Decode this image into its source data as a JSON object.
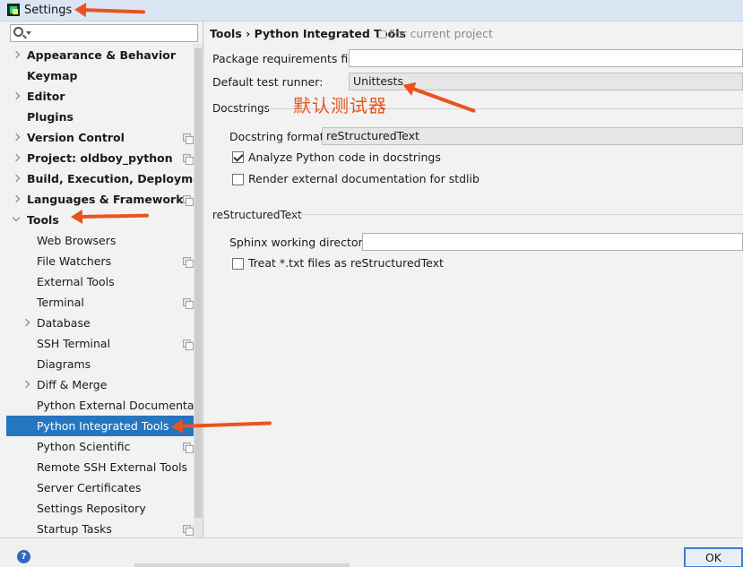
{
  "window": {
    "title": "Settings"
  },
  "search": {
    "placeholder": ""
  },
  "sidebar": {
    "items": [
      {
        "label": "Appearance & Behavior",
        "bold": true,
        "chevron": "closed",
        "indent": 0,
        "copy": false,
        "selected": false
      },
      {
        "label": "Keymap",
        "bold": true,
        "chevron": "none",
        "indent": 0,
        "copy": false,
        "selected": false
      },
      {
        "label": "Editor",
        "bold": true,
        "chevron": "closed",
        "indent": 0,
        "copy": false,
        "selected": false
      },
      {
        "label": "Plugins",
        "bold": true,
        "chevron": "none",
        "indent": 0,
        "copy": false,
        "selected": false
      },
      {
        "label": "Version Control",
        "bold": true,
        "chevron": "closed",
        "indent": 0,
        "copy": true,
        "selected": false
      },
      {
        "label": "Project: oldboy_python",
        "bold": true,
        "chevron": "closed",
        "indent": 0,
        "copy": true,
        "selected": false
      },
      {
        "label": "Build, Execution, Deployment",
        "bold": true,
        "chevron": "closed",
        "indent": 0,
        "copy": false,
        "selected": false
      },
      {
        "label": "Languages & Frameworks",
        "bold": true,
        "chevron": "closed",
        "indent": 0,
        "copy": true,
        "selected": false
      },
      {
        "label": "Tools",
        "bold": true,
        "chevron": "open",
        "indent": 0,
        "copy": false,
        "selected": false
      },
      {
        "label": "Web Browsers",
        "bold": false,
        "chevron": "none",
        "indent": 1,
        "copy": false,
        "selected": false
      },
      {
        "label": "File Watchers",
        "bold": false,
        "chevron": "none",
        "indent": 1,
        "copy": true,
        "selected": false
      },
      {
        "label": "External Tools",
        "bold": false,
        "chevron": "none",
        "indent": 1,
        "copy": false,
        "selected": false
      },
      {
        "label": "Terminal",
        "bold": false,
        "chevron": "none",
        "indent": 1,
        "copy": true,
        "selected": false
      },
      {
        "label": "Database",
        "bold": false,
        "chevron": "closed",
        "indent": 1,
        "copy": false,
        "selected": false
      },
      {
        "label": "SSH Terminal",
        "bold": false,
        "chevron": "none",
        "indent": 1,
        "copy": true,
        "selected": false
      },
      {
        "label": "Diagrams",
        "bold": false,
        "chevron": "none",
        "indent": 1,
        "copy": false,
        "selected": false
      },
      {
        "label": "Diff & Merge",
        "bold": false,
        "chevron": "closed",
        "indent": 1,
        "copy": false,
        "selected": false
      },
      {
        "label": "Python External Documentatior",
        "bold": false,
        "chevron": "none",
        "indent": 1,
        "copy": false,
        "selected": false
      },
      {
        "label": "Python Integrated Tools",
        "bold": false,
        "chevron": "none",
        "indent": 1,
        "copy": false,
        "selected": true
      },
      {
        "label": "Python Scientific",
        "bold": false,
        "chevron": "none",
        "indent": 1,
        "copy": true,
        "selected": false
      },
      {
        "label": "Remote SSH External Tools",
        "bold": false,
        "chevron": "none",
        "indent": 1,
        "copy": false,
        "selected": false
      },
      {
        "label": "Server Certificates",
        "bold": false,
        "chevron": "none",
        "indent": 1,
        "copy": false,
        "selected": false
      },
      {
        "label": "Settings Repository",
        "bold": false,
        "chevron": "none",
        "indent": 1,
        "copy": false,
        "selected": false
      },
      {
        "label": "Startup Tasks",
        "bold": false,
        "chevron": "none",
        "indent": 1,
        "copy": true,
        "selected": false
      }
    ]
  },
  "header": {
    "breadcrumb": "Tools › Python Integrated Tools",
    "scope": "For current project"
  },
  "form": {
    "package_requirements_label": "Package requirements file:",
    "package_requirements_value": "",
    "test_runner_label": "Default test runner:",
    "test_runner_value": "Unittests",
    "docstrings_section": "Docstrings",
    "docstring_format_label": "Docstring format:",
    "docstring_format_value": "reStructuredText",
    "analyze_label": "Analyze Python code in docstrings",
    "analyze_checked": true,
    "render_label": "Render external documentation for stdlib",
    "render_checked": false,
    "rst_section": "reStructuredText",
    "sphinx_label": "Sphinx working directory:",
    "sphinx_value": "",
    "treat_txt_label": "Treat *.txt files as reStructuredText",
    "treat_txt_checked": false
  },
  "annotation": {
    "text": "默认测试器",
    "color": "#e9541e"
  },
  "footer": {
    "help_label": "?",
    "ok_label": "OK"
  }
}
